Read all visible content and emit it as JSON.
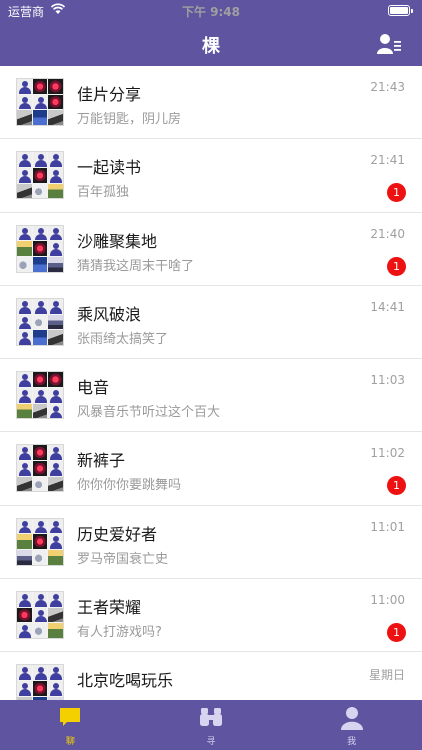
{
  "status_bar": {
    "carrier": "运营商",
    "time": "下午 9:48",
    "wifi_icon": "wifi-icon",
    "battery_icon": "battery-icon"
  },
  "nav": {
    "title": "棵",
    "right_icon": "contacts-icon"
  },
  "chats": [
    {
      "name": "佳片分享",
      "preview": "万能钥匙，阴儿房",
      "time": "21:43",
      "badge": ""
    },
    {
      "name": "一起读书",
      "preview": "百年孤独",
      "time": "21:41",
      "badge": "1"
    },
    {
      "name": "沙雕聚集地",
      "preview": "猜猜我这周末干啥了",
      "time": "21:40",
      "badge": "1"
    },
    {
      "name": "乘风破浪",
      "preview": "张雨绮太搞笑了",
      "time": "14:41",
      "badge": ""
    },
    {
      "name": "电音",
      "preview": "风暴音乐节听过这个百大",
      "time": "11:03",
      "badge": ""
    },
    {
      "name": "新裤子",
      "preview": "你你你你要跳舞吗",
      "time": "11:02",
      "badge": "1"
    },
    {
      "name": "历史爱好者",
      "preview": "罗马帝国衰亡史",
      "time": "11:01",
      "badge": ""
    },
    {
      "name": "王者荣耀",
      "preview": "有人打游戏吗?",
      "time": "11:00",
      "badge": "1"
    },
    {
      "name": "北京吃喝玩乐",
      "preview": "",
      "time": "星期日",
      "badge": ""
    }
  ],
  "tabs": [
    {
      "label": "聊",
      "icon": "chat-bubble-icon",
      "active": true
    },
    {
      "label": "寻",
      "icon": "binoculars-icon",
      "active": false
    },
    {
      "label": "我",
      "icon": "person-icon",
      "active": false
    }
  ],
  "colors": {
    "primary": "#5f54a0",
    "badge": "#ee1111",
    "active_tab": "#f5d000"
  }
}
